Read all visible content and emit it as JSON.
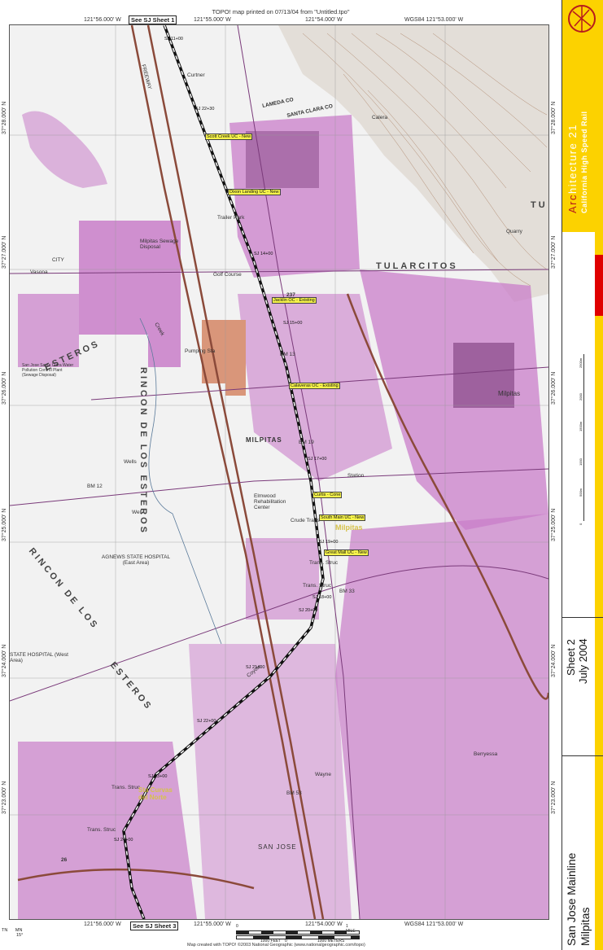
{
  "header": "TOPO! map printed on 07/13/04 from \"Untitled.tpo\"",
  "top_coords": [
    "121°56.000' W",
    "121°55.000' W",
    "121°54.000' W",
    "WGS84 121°53.000' W"
  ],
  "bottom_coords": [
    "121°56.000' W",
    "121°55.000' W",
    "121°54.000' W",
    "WGS84 121°53.000' W"
  ],
  "sheet_refs": {
    "top": "See SJ Sheet 1",
    "bottom": "See SJ Sheet 3"
  },
  "lat_labels": [
    "37°28.000' N",
    "37°27.000' N",
    "37°26.000' N",
    "37°25.000' N",
    "37°24.000' N",
    "37°23.000' N"
  ],
  "map_labels": {
    "curtner": "Curtner",
    "milpitas_town": "MILPITAS",
    "milpitas_east": "Milpitas",
    "milpitas_station": "Milpitas",
    "tularcitos": "TULARCITOS",
    "esteros": "ESTEROS",
    "rincon_los_esteros": "RINCON DE LOS ESTEROS",
    "rincon_de_los": "RINCON DE LOS",
    "esteros_lower": "ESTEROS",
    "lameda": "LAMEDA CO",
    "santa_clara_co": "SANTA CLARA CO",
    "sewage": "Milpitas Sewage Disposal",
    "agnews": "AGNEWS STATE HOSPITAL (East Area)",
    "agnews_west": "STATE HOSPITAL (West Area)",
    "elmwood": "Elmwood Rehabilitation Center",
    "berryessa": "Berryessa",
    "san_jose": "SAN JOSE",
    "wayne": "Wayne",
    "station_text": "Station",
    "golf": "Golf Course",
    "creek": "Creek",
    "coyote": "Coyote",
    "calera": "Calera",
    "tu": "TU",
    "quarry": "Quarry",
    "freeway": "FREEWAY",
    "pumping": "Pumping Sta",
    "trailer": "Trailer Park",
    "wells": "Wells",
    "wells2": "Well",
    "city": "CITY",
    "vasona_sj_hwy": "Vasona",
    "santa_clara_sj": "San Jose Santa Clara Water Pollution Control Plant (Sewage Disposal)",
    "bm13": "BM 13",
    "bm19": "BM 19",
    "bm33": "BM 33",
    "bm53": "BM 53",
    "bm12": "BM 12",
    "trans_struc1": "Trans. Struc",
    "trans_struc2": "Trans. Struc",
    "trans_struc3": "Trans. Struc",
    "trans_struc4": "Trans. Struc",
    "crude": "Crude Trans",
    "sta_curvas": "Sta Curvas del Norte",
    "milpitas_h": "Milpitas",
    "r26": "26",
    "r237": "237"
  },
  "crossings": [
    "Scott Creek UC - New",
    "Dixon Landing UC - New",
    "Jacklin OC - Existing",
    "Calaveras OC - Existing",
    "Curtis - Cone",
    "South Main UC - New",
    "Great Mall UC - New"
  ],
  "stations": [
    "SJ 11+00",
    "SJ 22+30",
    "SJ 14+00",
    "SJ 15+00",
    "SJ 17+00",
    "SJ 19+00",
    "SJ 18+00",
    "SJ 20+00",
    "SJ 21+00",
    "SJ 22+00",
    "SJ 23+00",
    "SJ 24+00"
  ],
  "north_arrow": {
    "tn": "TN",
    "mn": "MN",
    "decl": "15°"
  },
  "scale_labels": [
    "0",
    "1000 FEET",
    "0",
    "1 MILE",
    "1000 METERS"
  ],
  "credit": "Map created with TOPO! ©2003 National Geographic (www.nationalgeographic.com/topo)",
  "title_block": {
    "firm_arc": "Arc",
    "firm_rest": "hitecture 21",
    "project": "California High Speed Rail",
    "sheet": "Sheet 2",
    "date": "July 2004",
    "subtitle1": "San Jose Mainline",
    "subtitle2": "Milpitas",
    "scale_ticks": [
      "0",
      "500m",
      "1000",
      "1500m",
      "2000",
      "2500m"
    ]
  },
  "colors": {
    "urban": "#c97ec9",
    "urban_dark": "#7a3a7a",
    "bg": "#f2f2f2",
    "rail": "#111111",
    "highway": "#8b4a3a",
    "title_yellow": "#fcd200",
    "title_red": "#e00000",
    "orange_area": "#d9967a"
  }
}
